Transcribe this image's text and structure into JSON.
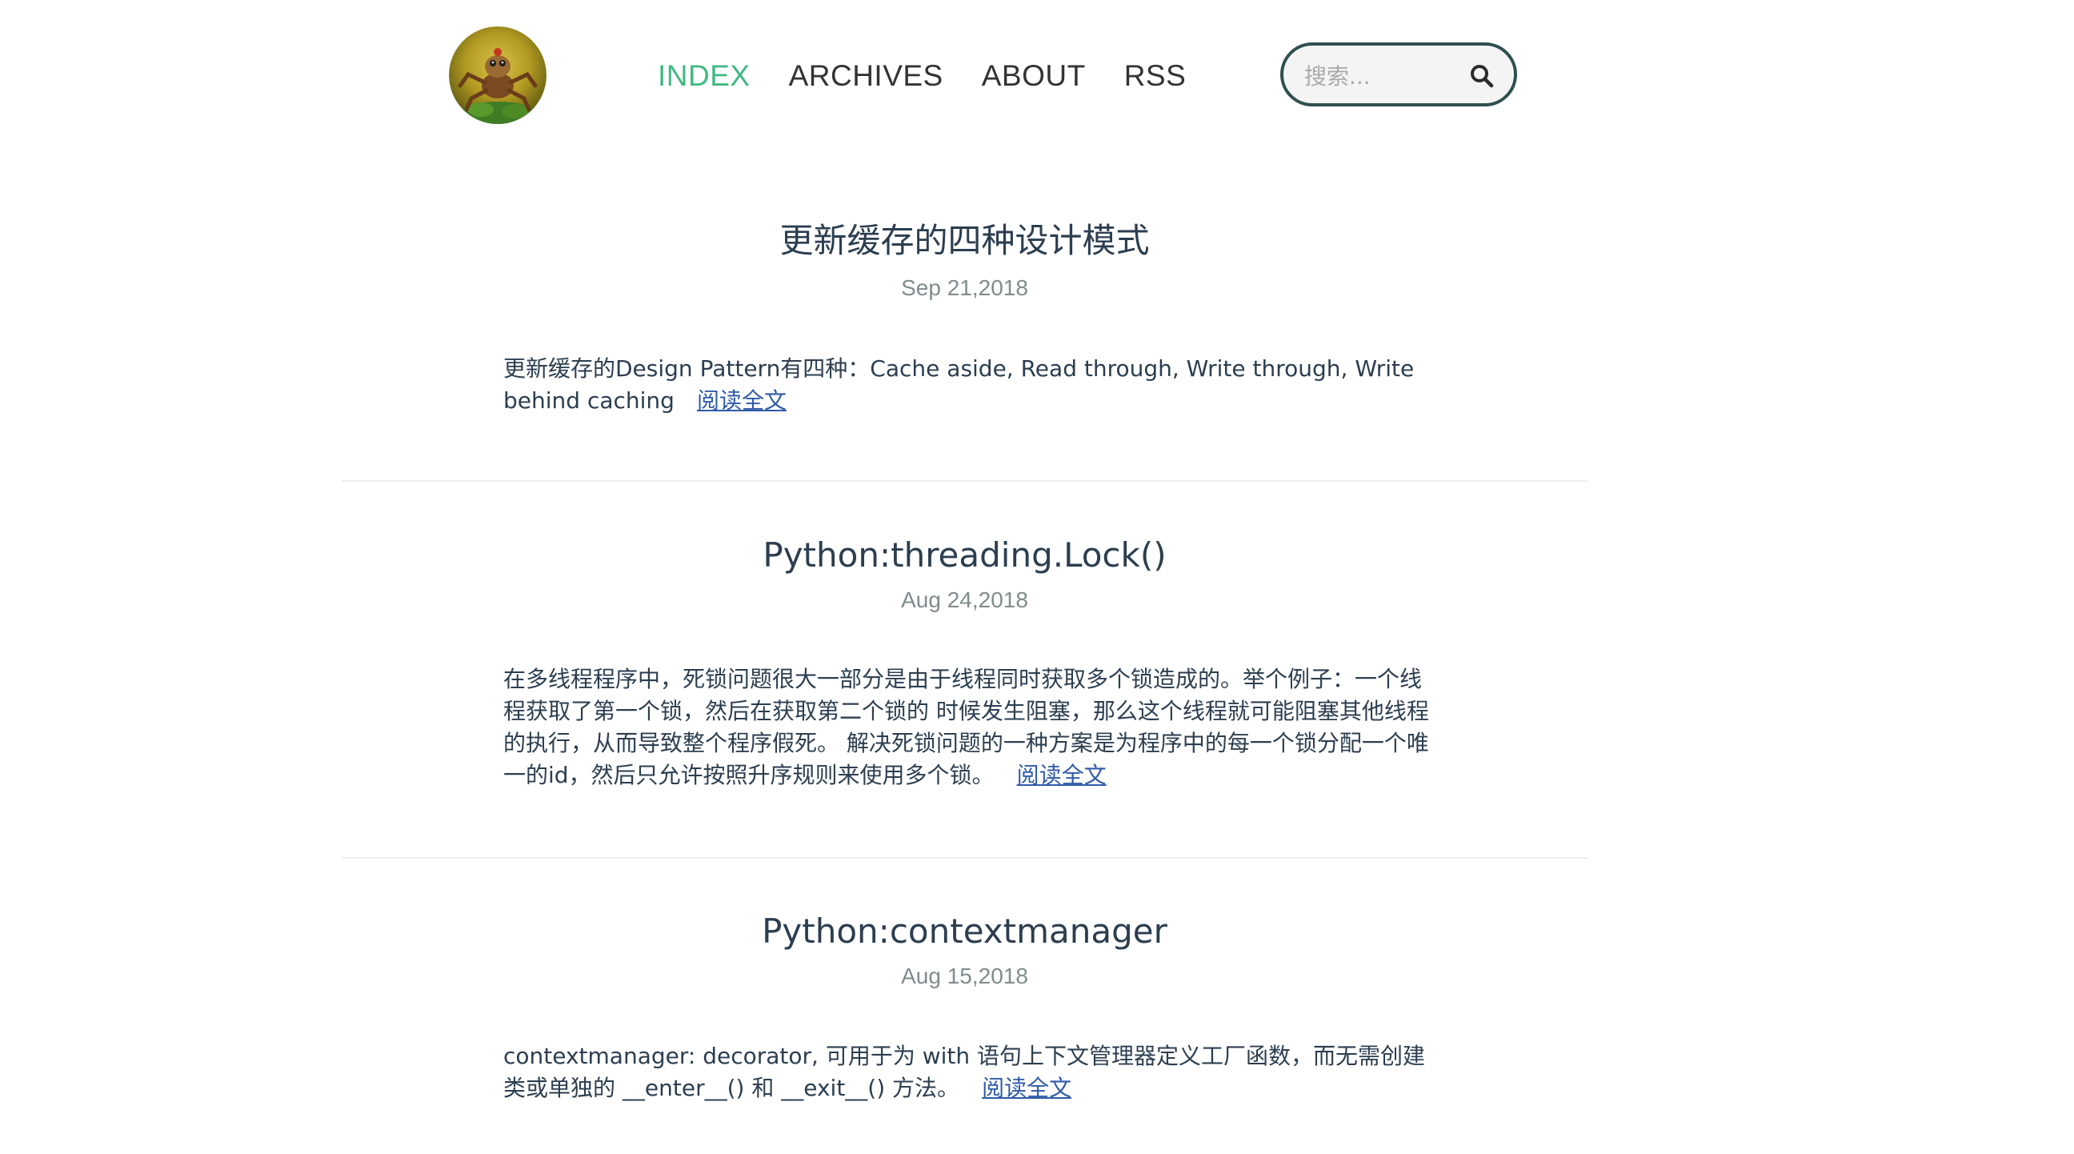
{
  "nav": {
    "items": [
      {
        "label": "INDEX",
        "active": true
      },
      {
        "label": "ARCHIVES",
        "active": false
      },
      {
        "label": "ABOUT",
        "active": false
      },
      {
        "label": "RSS",
        "active": false
      }
    ],
    "active_color": "#42b983"
  },
  "search": {
    "placeholder": "搜索...",
    "icon": "search-icon"
  },
  "avatar": {
    "icon": "avatar-image"
  },
  "posts": [
    {
      "title": "更新缓存的四种设计模式",
      "date": "Sep 21,2018",
      "excerpt": "更新缓存的Design Pattern有四种：Cache aside, Read through, Write through, Write behind caching",
      "read_more": "阅读全文"
    },
    {
      "title": "Python:threading.Lock()",
      "date": "Aug 24,2018",
      "excerpt": "在多线程程序中，死锁问题很大一部分是由于线程同时获取多个锁造成的。举个例子：一个线程获取了第一个锁，然后在获取第二个锁的 时候发生阻塞，那么这个线程就可能阻塞其他线程的执行，从而导致整个程序假死。 解决死锁问题的一种方案是为程序中的每一个锁分配一个唯一的id，然后只允许按照升序规则来使用多个锁。",
      "read_more": "阅读全文"
    },
    {
      "title": "Python:contextmanager",
      "date": "Aug 15,2018",
      "excerpt": "contextmanager: decorator, 可用于为 with 语句上下文管理器定义工厂函数，而无需创建类或单独的 __enter__() 和 __exit__() 方法。",
      "read_more": "阅读全文"
    }
  ]
}
